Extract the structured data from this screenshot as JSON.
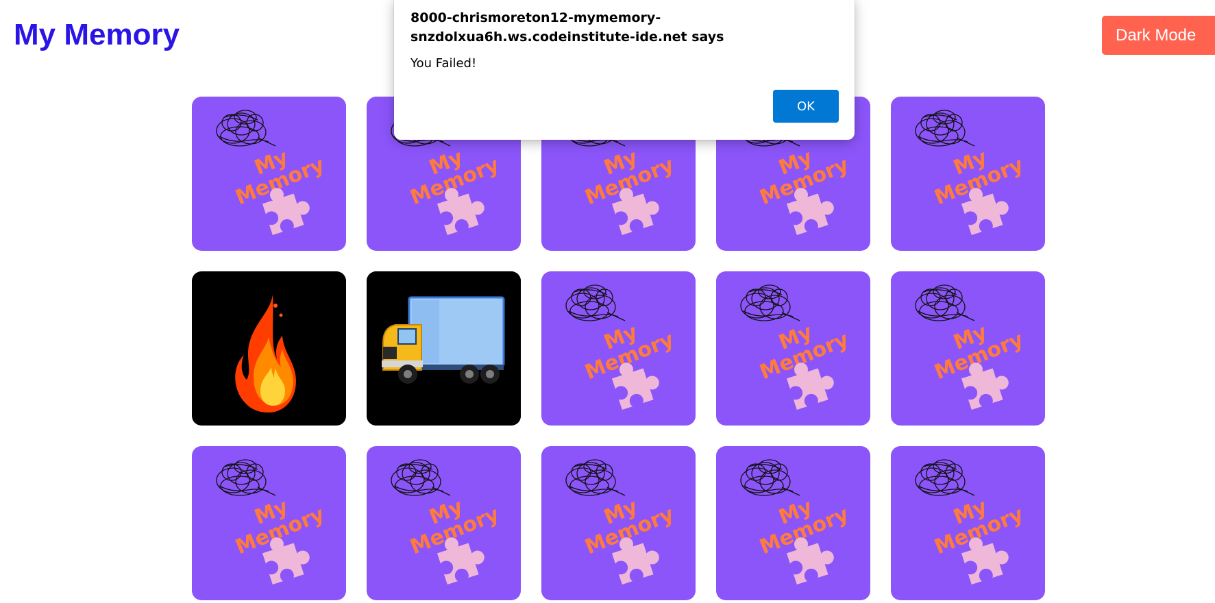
{
  "app": {
    "title": "My Memory"
  },
  "header": {
    "theme_toggle_label": "Dark Mode"
  },
  "dialog": {
    "origin": "8000-chrismoreton12-mymemory-snzdolxua6h.ws.codeinstitute-ide.net says",
    "message": "You Failed!",
    "ok_label": "OK"
  },
  "board": {
    "card_back_logo_text": [
      "My",
      "Memory"
    ],
    "cards": [
      {
        "state": "face-down",
        "face": ""
      },
      {
        "state": "face-down",
        "face": ""
      },
      {
        "state": "face-down",
        "face": ""
      },
      {
        "state": "face-down",
        "face": ""
      },
      {
        "state": "face-down",
        "face": ""
      },
      {
        "state": "face-up",
        "face": "fire-icon"
      },
      {
        "state": "face-up",
        "face": "truck-icon"
      },
      {
        "state": "face-down",
        "face": ""
      },
      {
        "state": "face-down",
        "face": ""
      },
      {
        "state": "face-down",
        "face": ""
      },
      {
        "state": "face-down",
        "face": ""
      },
      {
        "state": "face-down",
        "face": ""
      },
      {
        "state": "face-down",
        "face": ""
      },
      {
        "state": "face-down",
        "face": ""
      },
      {
        "state": "face-down",
        "face": ""
      }
    ]
  },
  "colors": {
    "title": "#2a14e6",
    "card_back": "#8b55fa",
    "card_front": "#000000",
    "logo_text": "#ff7a3d",
    "puzzle_piece": "#efb8d8",
    "theme_button": "#ff624f",
    "dialog_ok": "#0078d4"
  }
}
